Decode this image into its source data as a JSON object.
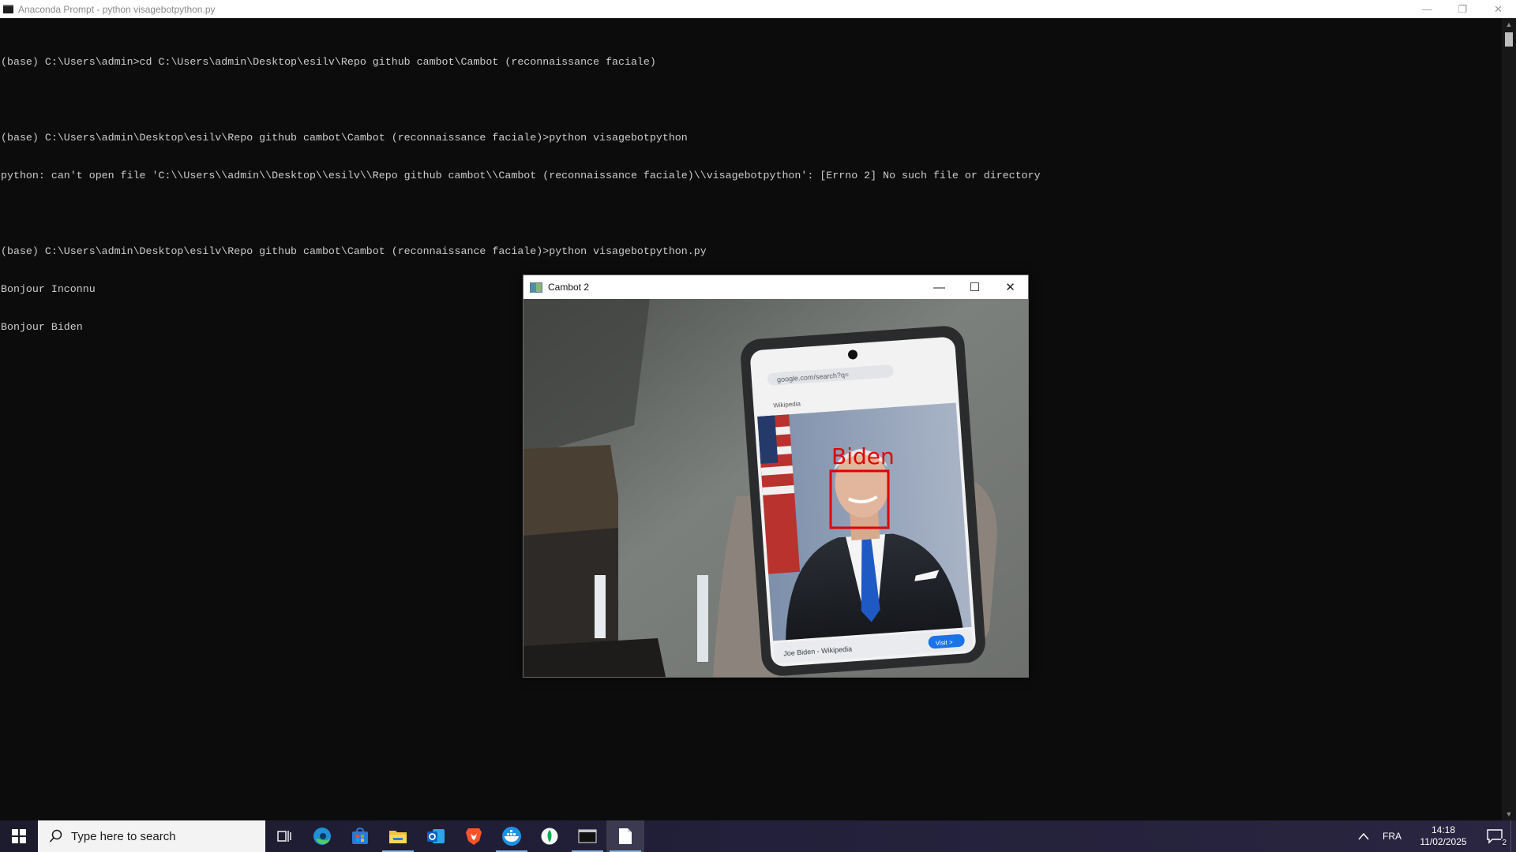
{
  "console": {
    "title": "Anaconda Prompt - python  visagebotpython.py",
    "lines": [
      "(base) C:\\Users\\admin>cd C:\\Users\\admin\\Desktop\\esilv\\Repo github cambot\\Cambot (reconnaissance faciale)",
      "",
      "(base) C:\\Users\\admin\\Desktop\\esilv\\Repo github cambot\\Cambot (reconnaissance faciale)>python visagebotpython",
      "python: can't open file 'C:\\\\Users\\\\admin\\\\Desktop\\\\esilv\\\\Repo github cambot\\\\Cambot (reconnaissance faciale)\\\\visagebotpython': [Errno 2] No such file or directory",
      "",
      "(base) C:\\Users\\admin\\Desktop\\esilv\\Repo github cambot\\Cambot (reconnaissance faciale)>python visagebotpython.py",
      "Bonjour Inconnu",
      "Bonjour Biden"
    ]
  },
  "cambot": {
    "title": "Cambot 2",
    "detection_label": "Biden",
    "phone": {
      "url": "google.com/search?q=",
      "source_tag": "Wikipedia",
      "footer_text": "Joe Biden - Wikipedia",
      "visit_label": "Visit >"
    }
  },
  "taskbar": {
    "search_placeholder": "Type here to search",
    "language": "FRA",
    "time": "14:18",
    "date": "11/02/2025",
    "notification_count": "2"
  },
  "colors": {
    "console_bg": "#0c0c0c",
    "console_text": "#cccccc",
    "detection_red": "#e00000",
    "taskbar_bg": "#1d1b2e",
    "accent": "#76b9ed"
  }
}
